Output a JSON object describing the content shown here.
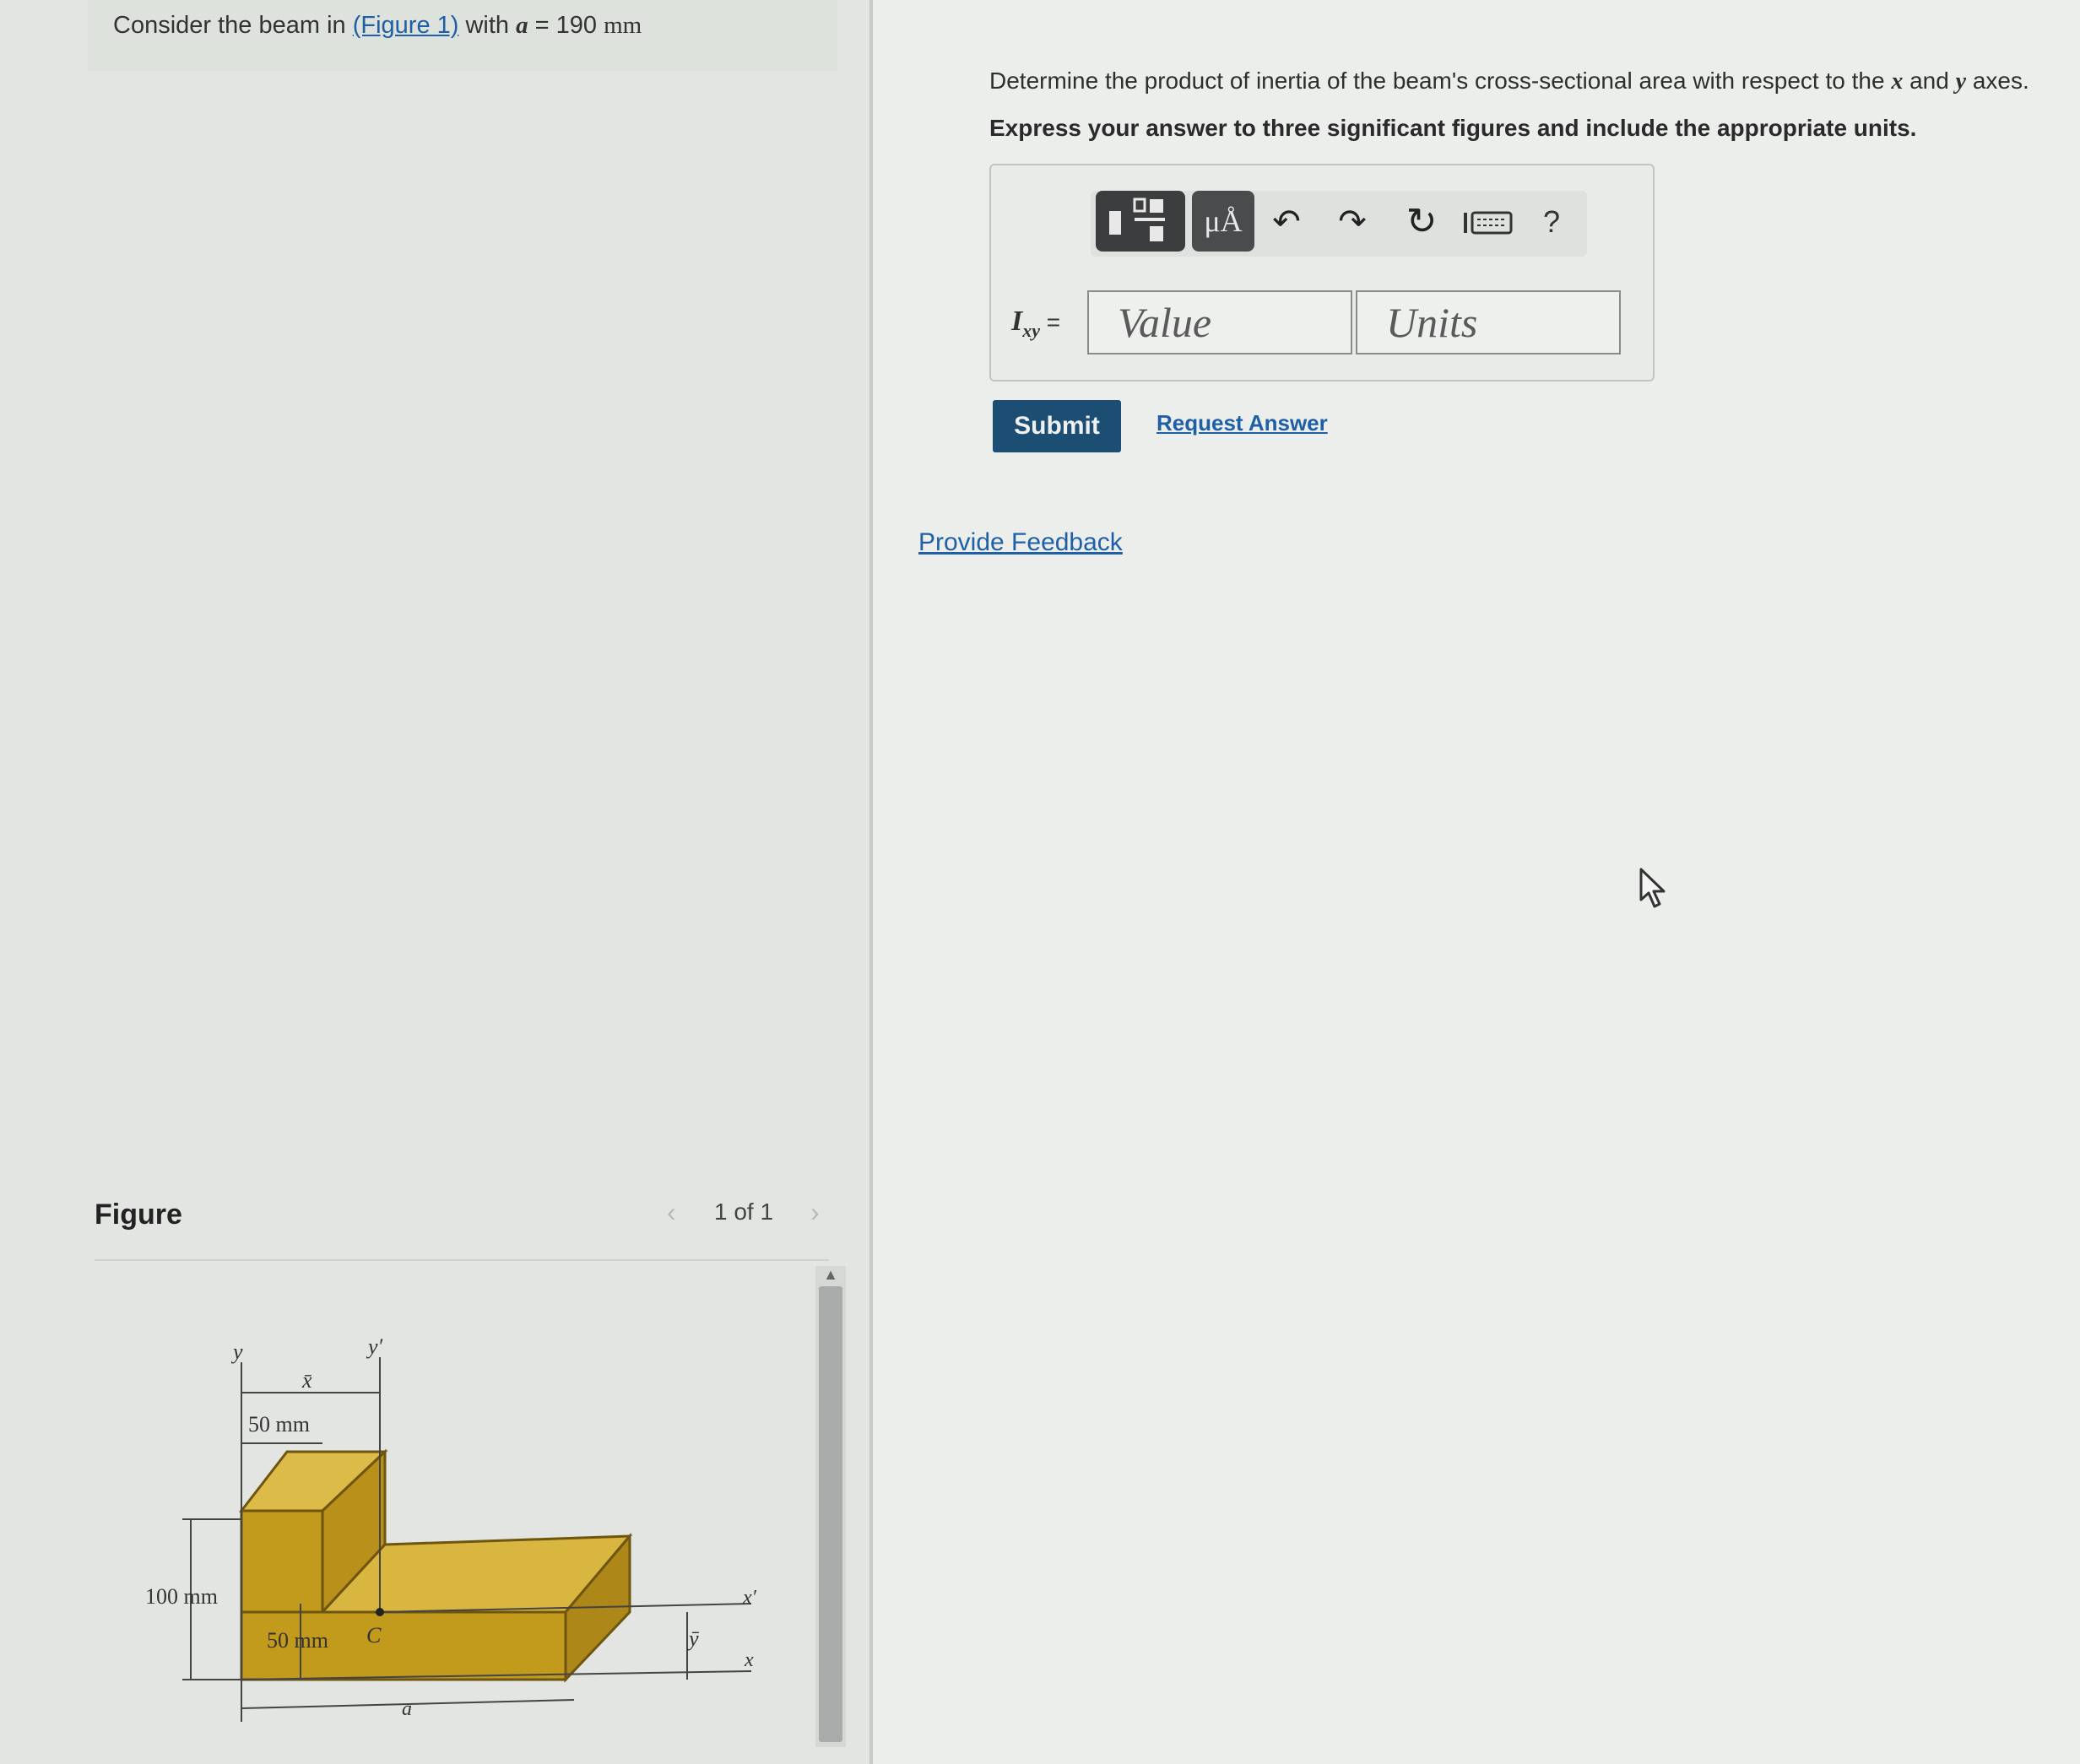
{
  "intro": {
    "prefix": "Consider the beam in ",
    "link": "(Figure 1)",
    "with_text": " with ",
    "var": "a",
    "equals": " = 190 ",
    "unit": "mm"
  },
  "figure": {
    "label": "Figure",
    "pager_count": "1 of 1",
    "prev_icon": "chevron-left-icon",
    "next_icon": "chevron-right-icon",
    "labels": {
      "y": "y",
      "y_prime": "y′",
      "x_bar": "x̄",
      "y_bar": "ȳ",
      "x": "x",
      "x_prime": "x′",
      "c": "C",
      "a": "a",
      "top_width": "50 mm",
      "bottom_dim": "50 mm",
      "height_dim": "100 mm"
    },
    "beam_color": "#c9a227"
  },
  "question": {
    "text_prefix": "Determine the product of inertia of the beam's cross-sectional area with respect to the ",
    "x": "x",
    "and_text": " and ",
    "y": "y",
    "text_suffix": " axes.",
    "instruction": "Express your answer to three significant figures and include the appropriate units."
  },
  "answer": {
    "toolbar": {
      "templates_icon": "templates-icon",
      "units_label": "μÅ",
      "undo_icon": "undo-icon",
      "redo_icon": "redo-icon",
      "reset_icon": "reset-icon",
      "keyboard_icon": "keyboard-icon",
      "help_label": "?"
    },
    "var_main": "I",
    "var_sub": "xy",
    "var_eq": " =",
    "value_placeholder": "Value",
    "units_placeholder": "Units"
  },
  "buttons": {
    "submit": "Submit",
    "request_answer": "Request Answer"
  },
  "feedback": "Provide Feedback",
  "colors": {
    "submit_bg": "#1c4e74",
    "link": "#1f5fa6"
  }
}
